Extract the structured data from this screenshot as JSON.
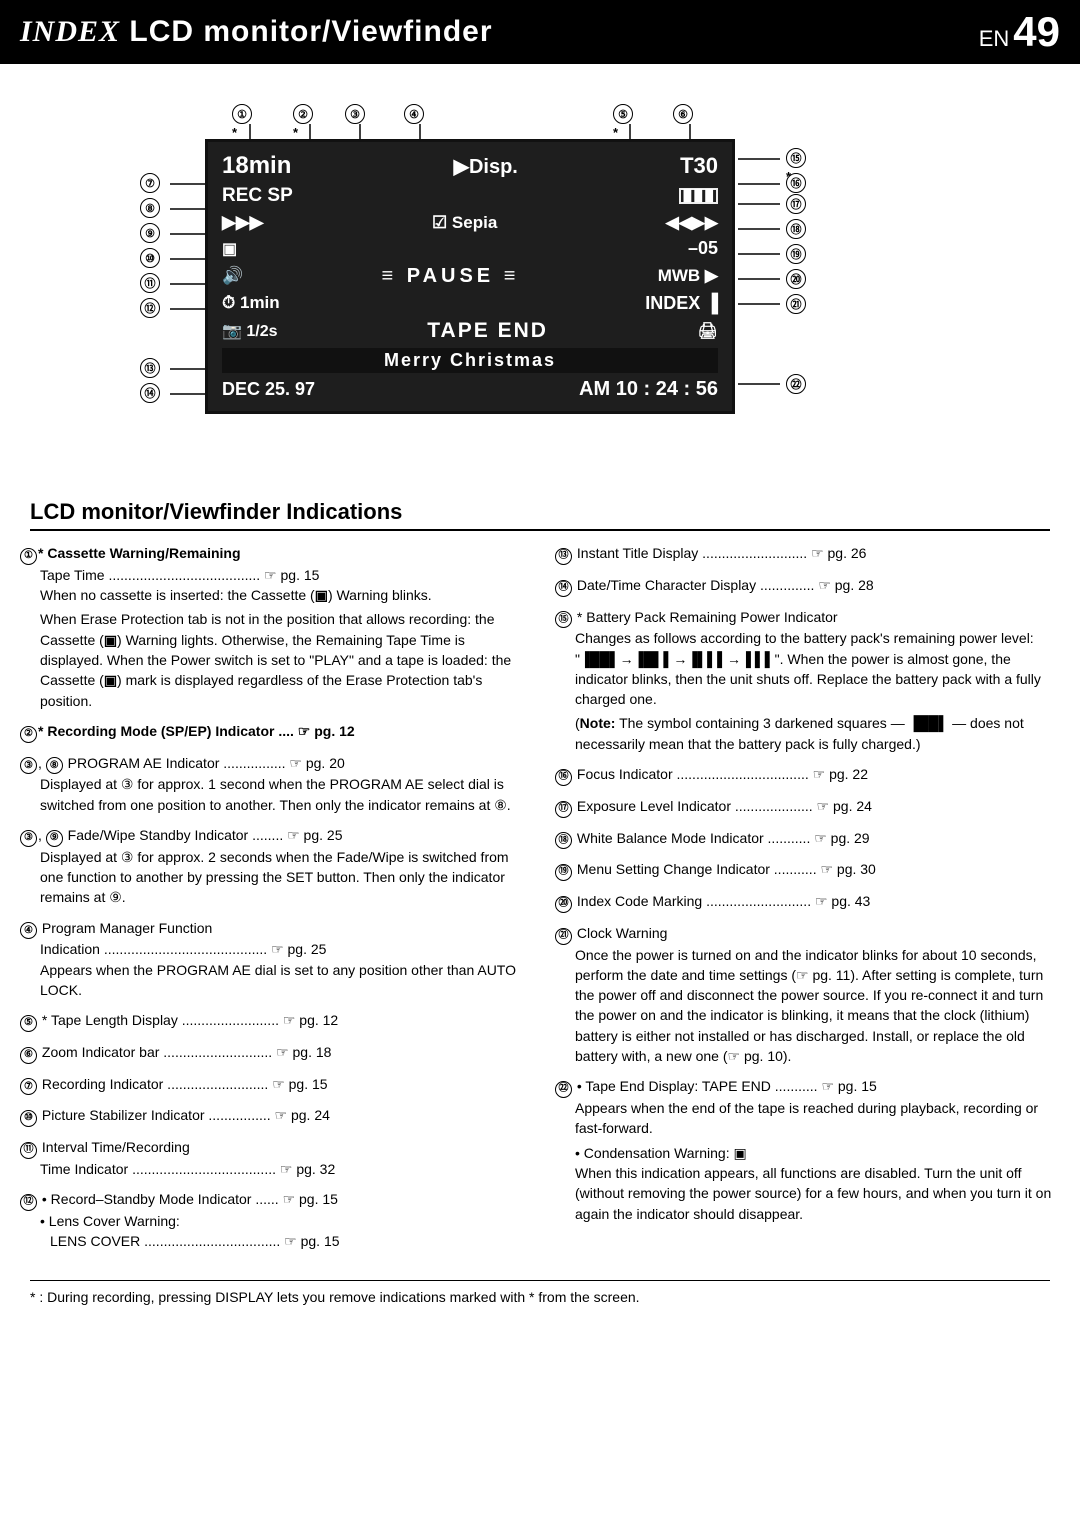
{
  "header": {
    "brand": "INDEX",
    "subtitle": "LCD monitor/Viewfinder",
    "en_label": "EN",
    "page_number": "49"
  },
  "diagram": {
    "lcd_rows": [
      {
        "id": "r1",
        "left": "18min",
        "mid": "▶Disp.",
        "right": "T30"
      },
      {
        "id": "r2",
        "left": "REC SP",
        "mid": "",
        "right": "▐█▌▌"
      },
      {
        "id": "r3",
        "left": "▶▶▶",
        "mid": "✓Sepia",
        "right": "◀◀▶▶"
      },
      {
        "id": "r4",
        "left": "▣",
        "mid": "",
        "right": "–05"
      },
      {
        "id": "r5",
        "left": "🔊",
        "mid": "≡ PAUSE ≡",
        "right": "MWB ▶"
      },
      {
        "id": "r6",
        "left": "⏱ 1min",
        "mid": "",
        "right": "INDEX"
      },
      {
        "id": "r7",
        "left": "📷 1/2s",
        "mid": "TAPE END",
        "right": "🖨"
      },
      {
        "id": "r8",
        "left": "",
        "mid": "Merry  Christmas",
        "right": ""
      },
      {
        "id": "r9",
        "left": "DEC 25. 97",
        "mid": "",
        "right": "AM 10 : 24 : 56"
      }
    ],
    "callouts_top": [
      "①*",
      "②*",
      "③",
      "④",
      "⑤*",
      "⑥"
    ],
    "callouts_left": [
      "⑦",
      "⑧",
      "⑨",
      "⑩",
      "⑪",
      "⑫",
      "⑬",
      "⑭"
    ],
    "callouts_right": [
      "⑮*",
      "⑯",
      "⑰",
      "⑱",
      "⑲",
      "⑳",
      "㉑",
      "㉒"
    ]
  },
  "section_title": "LCD monitor/Viewfinder Indications",
  "items_left": [
    {
      "num": "①",
      "star": true,
      "text": "Cassette Warning/Remaining",
      "lines": [
        "Tape Time ....................................... ☞ pg. 15",
        "When no cassette is inserted: the Cassette (▣) Warning blinks.",
        "When Erase Protection tab is not in the position that allows recording: the Cassette (▣) Warning lights. Otherwise, the Remaining Tape Time is displayed. When the Power switch is set to \"PLAY\" and a tape is loaded: the Cassette (▣) mark is displayed regardless of the Erase Protection tab's position."
      ]
    },
    {
      "num": "②",
      "star": true,
      "text": "Recording Mode (SP/EP) Indicator .... ☞ pg. 12"
    },
    {
      "num": "③⑧",
      "star": false,
      "text": "PROGRAM AE Indicator ................ ☞ pg. 20",
      "lines": [
        "Displayed at ③ for approx. 1 second when the PROGRAM AE select dial is switched from one position to another. Then only the indicator remains at ⑧."
      ]
    },
    {
      "num": "③⑨",
      "star": false,
      "text": "Fade/Wipe Standby Indicator ........ ☞ pg. 25",
      "lines": [
        "Displayed at ③ for approx. 2 seconds when the Fade/Wipe is switched from one function to another by pressing the SET button. Then only the indicator remains at ⑨."
      ]
    },
    {
      "num": "④",
      "star": false,
      "text": "Program Manager Function",
      "lines": [
        "Indication .......................................... ☞ pg. 25",
        "Appears when the PROGRAM AE dial is set to any position other than AUTO LOCK."
      ]
    },
    {
      "num": "⑤",
      "star": true,
      "text": "Tape Length Display ......................... ☞ pg. 12"
    },
    {
      "num": "⑥",
      "star": false,
      "text": "Zoom Indicator bar ............................ ☞ pg. 18"
    },
    {
      "num": "⑦",
      "star": false,
      "text": "Recording Indicator .......................... ☞ pg. 15"
    },
    {
      "num": "⑩",
      "star": false,
      "text": "Picture Stabilizer Indicator ................ ☞ pg. 24"
    },
    {
      "num": "⑪",
      "star": false,
      "text": "Interval Time/Recording",
      "lines": [
        "Time Indicator ..................................... ☞ pg. 32"
      ]
    },
    {
      "num": "⑫",
      "star": false,
      "text": "• Record–Standby Mode Indicator ...... ☞ pg. 15",
      "lines": [
        "• Lens Cover Warning:",
        "  LENS COVER ................................... ☞ pg. 15"
      ]
    }
  ],
  "items_right": [
    {
      "num": "⑬",
      "star": false,
      "text": "Instant Title Display ........................... ☞ pg. 26"
    },
    {
      "num": "⑭",
      "star": false,
      "text": "Date/Time Character Display .............. ☞ pg. 28"
    },
    {
      "num": "⑮",
      "star": true,
      "text": "Battery Pack Remaining Power Indicator",
      "lines": [
        "Changes as follows according to the battery pack's remaining power level:",
        "\"▐██▌→▐█▌▌→▐▌▌▌→▐ ▌▌\". When the power is almost gone, the indicator blinks, then the unit shuts off. Replace the battery pack with a fully charged one.",
        "(Note: The symbol containing 3 darkened squares — ▐██▌ — does not necessarily mean that the battery pack is fully charged.)"
      ]
    },
    {
      "num": "⑯",
      "star": false,
      "text": "Focus Indicator .................................. ☞ pg. 22"
    },
    {
      "num": "⑰",
      "star": false,
      "text": "Exposure Level Indicator .................... ☞ pg. 24"
    },
    {
      "num": "⑱",
      "star": false,
      "text": "White Balance Mode Indicator ........... ☞ pg. 29"
    },
    {
      "num": "⑲",
      "star": false,
      "text": "Menu Setting Change Indicator ........... ☞ pg. 30"
    },
    {
      "num": "⑳",
      "star": false,
      "text": "Index Code Marking ........................... ☞ pg. 43"
    },
    {
      "num": "㉑",
      "star": false,
      "text": "Clock Warning",
      "lines": [
        "Once the power is turned on and the indicator blinks for about 10 seconds, perform the date and time settings (☞ pg. 11). After setting is complete, turn the power off and disconnect the power source. If you re-connect it and turn the power on and the indicator is blinking, it means that the clock (lithium) battery is either not installed or has discharged. Install, or replace the old battery with, a new one (☞ pg. 10)."
      ]
    },
    {
      "num": "㉒",
      "star": false,
      "text": "• Tape End Display: TAPE END ........... ☞ pg. 15",
      "lines": [
        "Appears when the end of the tape is reached during playback, recording or fast-forward.",
        "• Condensation Warning: 🔵",
        "When this indication appears, all functions are disabled. Turn the unit off (without removing the power source) for a few hours, and when you turn it on again the indicator should disappear."
      ]
    }
  ],
  "footer": "* : During recording, pressing DISPLAY lets you remove indications marked with * from the screen."
}
